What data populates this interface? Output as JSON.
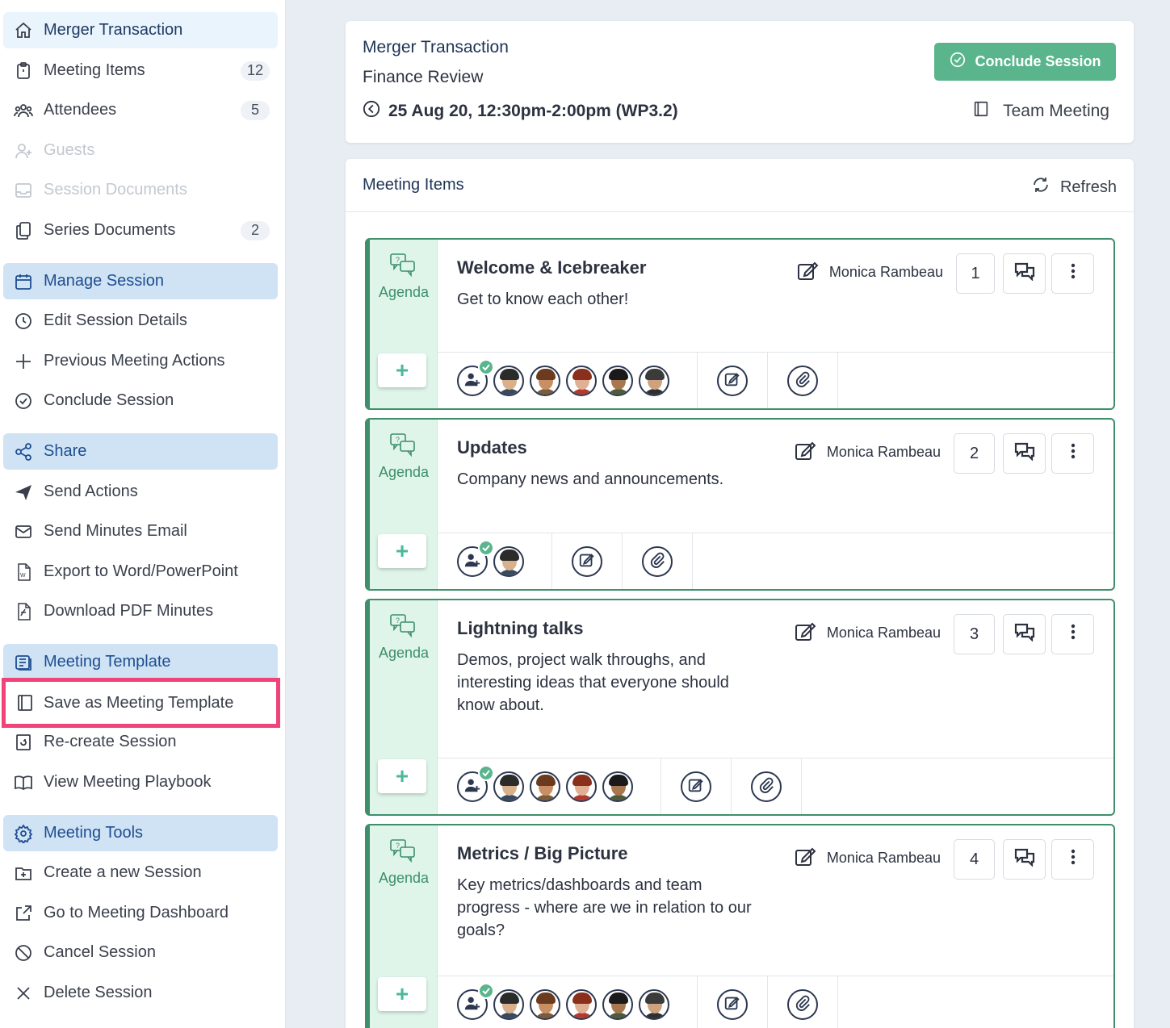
{
  "sidebar": {
    "home": "Merger Transaction",
    "meeting_items": {
      "label": "Meeting Items",
      "count": "12"
    },
    "attendees": {
      "label": "Attendees",
      "count": "5"
    },
    "guests": "Guests",
    "session_documents": "Session Documents",
    "series_documents": {
      "label": "Series Documents",
      "count": "2"
    },
    "manage_session": "Manage Session",
    "edit_session_details": "Edit Session Details",
    "previous_meeting_actions": "Previous Meeting Actions",
    "conclude_session": "Conclude Session",
    "share": "Share",
    "send_actions": "Send Actions",
    "send_minutes_email": "Send Minutes Email",
    "export_word": "Export to Word/PowerPoint",
    "download_pdf": "Download PDF Minutes",
    "meeting_template": "Meeting Template",
    "save_as_template": "Save as Meeting Template",
    "recreate_session": "Re-create Session",
    "view_playbook": "View Meeting Playbook",
    "meeting_tools": "Meeting Tools",
    "create_new_session": "Create a new Session",
    "go_to_dashboard": "Go to Meeting Dashboard",
    "cancel_session": "Cancel Session",
    "delete_session": "Delete Session"
  },
  "header": {
    "title": "Merger Transaction",
    "subtitle": "Finance Review",
    "datetime": "25 Aug 20, 12:30pm-2:00pm (WP3.2)",
    "conclude_button": "Conclude Session",
    "meeting_type": "Team Meeting"
  },
  "items_panel": {
    "title": "Meeting Items",
    "refresh": "Refresh",
    "agenda_label": "Agenda",
    "plus": "+",
    "items": [
      {
        "title": "Welcome & Icebreaker",
        "description": "Get to know each other!",
        "owner": "Monica Rambeau",
        "number": "1"
      },
      {
        "title": "Updates",
        "description": "Company news and announcements.",
        "owner": "Monica Rambeau",
        "number": "2"
      },
      {
        "title": "Lightning talks",
        "description": "Demos, project walk throughs, and interesting ideas that everyone should know about.",
        "owner": "Monica Rambeau",
        "number": "3"
      },
      {
        "title": "Metrics / Big Picture",
        "description": "Key metrics/dashboards and team progress - where are we in relation to our goals?",
        "owner": "Monica Rambeau",
        "number": "4"
      }
    ]
  },
  "colors": {
    "accent_green": "#5ab58d",
    "item_border": "#3e8f6a",
    "section_header_bg": "#cfe3f5",
    "highlight_pink": "#f0437a"
  }
}
